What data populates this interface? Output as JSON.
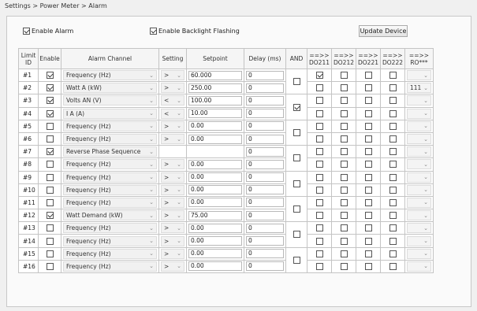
{
  "breadcrumb": "Settings > Power Meter > Alarm",
  "enable_alarm": {
    "label": "Enable Alarm",
    "checked": true
  },
  "enable_backlight": {
    "label": "Enable Backlight Flashing",
    "checked": true
  },
  "update_button": "Update Device",
  "headers": {
    "limit_id": "Limit ID",
    "enable": "Enable",
    "channel": "Alarm Channel",
    "setting": "Setting",
    "setpoint": "Setpoint",
    "delay": "Delay (ms)",
    "and": "AND",
    "do211": "==>> DO211",
    "do212": "==>> DO212",
    "do221": "==>> DO221",
    "do222": "==>> DO222",
    "ro": "==>> RO***"
  },
  "and_groups": [
    false,
    true,
    false,
    false,
    false,
    false,
    false,
    false
  ],
  "rows": [
    {
      "id": "#1",
      "enable": true,
      "channel": "Frequency (Hz)",
      "setting": ">",
      "setpoint": "60.000",
      "delay": "0",
      "do211": true,
      "do212": false,
      "do221": false,
      "do222": false,
      "ro": ""
    },
    {
      "id": "#2",
      "enable": true,
      "channel": "Watt A (kW)",
      "setting": ">",
      "setpoint": "250.00",
      "delay": "0",
      "do211": false,
      "do212": false,
      "do221": false,
      "do222": false,
      "ro": "111"
    },
    {
      "id": "#3",
      "enable": true,
      "channel": "Volts AN (V)",
      "setting": "<",
      "setpoint": "100.00",
      "delay": "0",
      "do211": false,
      "do212": false,
      "do221": false,
      "do222": false,
      "ro": ""
    },
    {
      "id": "#4",
      "enable": true,
      "channel": "I A (A)",
      "setting": "<",
      "setpoint": "10.00",
      "delay": "0",
      "do211": false,
      "do212": false,
      "do221": false,
      "do222": false,
      "ro": ""
    },
    {
      "id": "#5",
      "enable": false,
      "channel": "Frequency (Hz)",
      "setting": ">",
      "setpoint": "0.00",
      "delay": "0",
      "do211": false,
      "do212": false,
      "do221": false,
      "do222": false,
      "ro": ""
    },
    {
      "id": "#6",
      "enable": false,
      "channel": "Frequency (Hz)",
      "setting": ">",
      "setpoint": "0.00",
      "delay": "0",
      "do211": false,
      "do212": false,
      "do221": false,
      "do222": false,
      "ro": ""
    },
    {
      "id": "#7",
      "enable": true,
      "channel": "Reverse Phase Sequence",
      "setting": "",
      "setpoint": "",
      "delay": "0",
      "do211": false,
      "do212": false,
      "do221": false,
      "do222": false,
      "ro": ""
    },
    {
      "id": "#8",
      "enable": false,
      "channel": "Frequency (Hz)",
      "setting": ">",
      "setpoint": "0.00",
      "delay": "0",
      "do211": false,
      "do212": false,
      "do221": false,
      "do222": false,
      "ro": ""
    },
    {
      "id": "#9",
      "enable": false,
      "channel": "Frequency (Hz)",
      "setting": ">",
      "setpoint": "0.00",
      "delay": "0",
      "do211": false,
      "do212": false,
      "do221": false,
      "do222": false,
      "ro": ""
    },
    {
      "id": "#10",
      "enable": false,
      "channel": "Frequency (Hz)",
      "setting": ">",
      "setpoint": "0.00",
      "delay": "0",
      "do211": false,
      "do212": false,
      "do221": false,
      "do222": false,
      "ro": ""
    },
    {
      "id": "#11",
      "enable": false,
      "channel": "Frequency (Hz)",
      "setting": ">",
      "setpoint": "0.00",
      "delay": "0",
      "do211": false,
      "do212": false,
      "do221": false,
      "do222": false,
      "ro": ""
    },
    {
      "id": "#12",
      "enable": true,
      "channel": "Watt Demand (kW)",
      "setting": ">",
      "setpoint": "75.00",
      "delay": "0",
      "do211": false,
      "do212": false,
      "do221": false,
      "do222": false,
      "ro": ""
    },
    {
      "id": "#13",
      "enable": false,
      "channel": "Frequency (Hz)",
      "setting": ">",
      "setpoint": "0.00",
      "delay": "0",
      "do211": false,
      "do212": false,
      "do221": false,
      "do222": false,
      "ro": ""
    },
    {
      "id": "#14",
      "enable": false,
      "channel": "Frequency (Hz)",
      "setting": ">",
      "setpoint": "0.00",
      "delay": "0",
      "do211": false,
      "do212": false,
      "do221": false,
      "do222": false,
      "ro": ""
    },
    {
      "id": "#15",
      "enable": false,
      "channel": "Frequency (Hz)",
      "setting": ">",
      "setpoint": "0.00",
      "delay": "0",
      "do211": false,
      "do212": false,
      "do221": false,
      "do222": false,
      "ro": ""
    },
    {
      "id": "#16",
      "enable": false,
      "channel": "Frequency (Hz)",
      "setting": ">",
      "setpoint": "0.00",
      "delay": "0",
      "do211": false,
      "do212": false,
      "do221": false,
      "do222": false,
      "ro": ""
    }
  ]
}
